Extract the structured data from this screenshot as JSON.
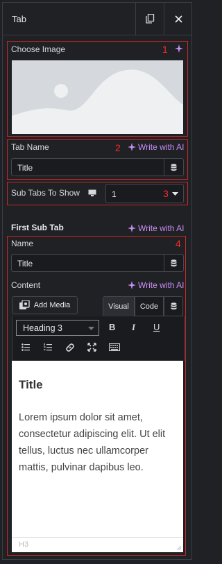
{
  "panel_title": "Tab",
  "section1": {
    "label": "Choose Image",
    "number": "1"
  },
  "section2": {
    "label": "Tab Name",
    "number": "2",
    "ai_label": "Write with AI",
    "value": "Title"
  },
  "section3": {
    "label": "Sub Tabs To Show",
    "number": "3",
    "value": "1"
  },
  "subtab": {
    "heading": "First Sub Tab",
    "ai_label": "Write with AI",
    "number": "4",
    "name_label": "Name",
    "name_value": "Title",
    "content_label": "Content",
    "content_ai_label": "Write with AI",
    "add_media": "Add Media",
    "tab_visual": "Visual",
    "tab_code": "Code",
    "format_select": "Heading 3",
    "tb_bold": "B",
    "tb_italic": "I",
    "tb_underline": "U",
    "editor_title": "Title",
    "editor_body": "Lorem ipsum dolor sit amet, consectetur adipiscing elit. Ut elit tellus, luctus nec ullamcorper mattis, pulvinar dapibus leo.",
    "status_path": "H3"
  },
  "colors": {
    "accent_ai": "#c88df4",
    "highlight_red": "#c62828",
    "background": "#1f2124"
  }
}
